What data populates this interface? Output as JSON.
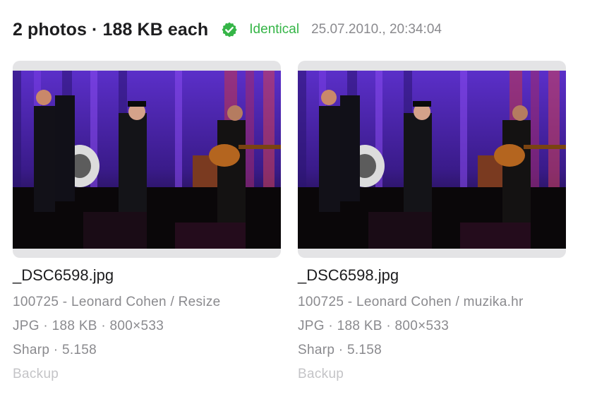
{
  "header": {
    "title": "2 photos · 188 KB each",
    "status": "Identical",
    "date": "25.07.2010., 20:34:04",
    "status_color": "#35b547",
    "check_icon": "check-seal-icon"
  },
  "photos": [
    {
      "filename": "_DSC6598.jpg",
      "path": "100725 - Leonard Cohen / Resize",
      "info": "JPG · 188 KB · 800×533",
      "sharpness": "Sharp · 5.158",
      "tag": "Backup"
    },
    {
      "filename": "_DSC6598.jpg",
      "path": "100725 - Leonard Cohen / muzika.hr",
      "info": "JPG · 188 KB · 800×533",
      "sharpness": "Sharp · 5.158",
      "tag": "Backup"
    }
  ]
}
